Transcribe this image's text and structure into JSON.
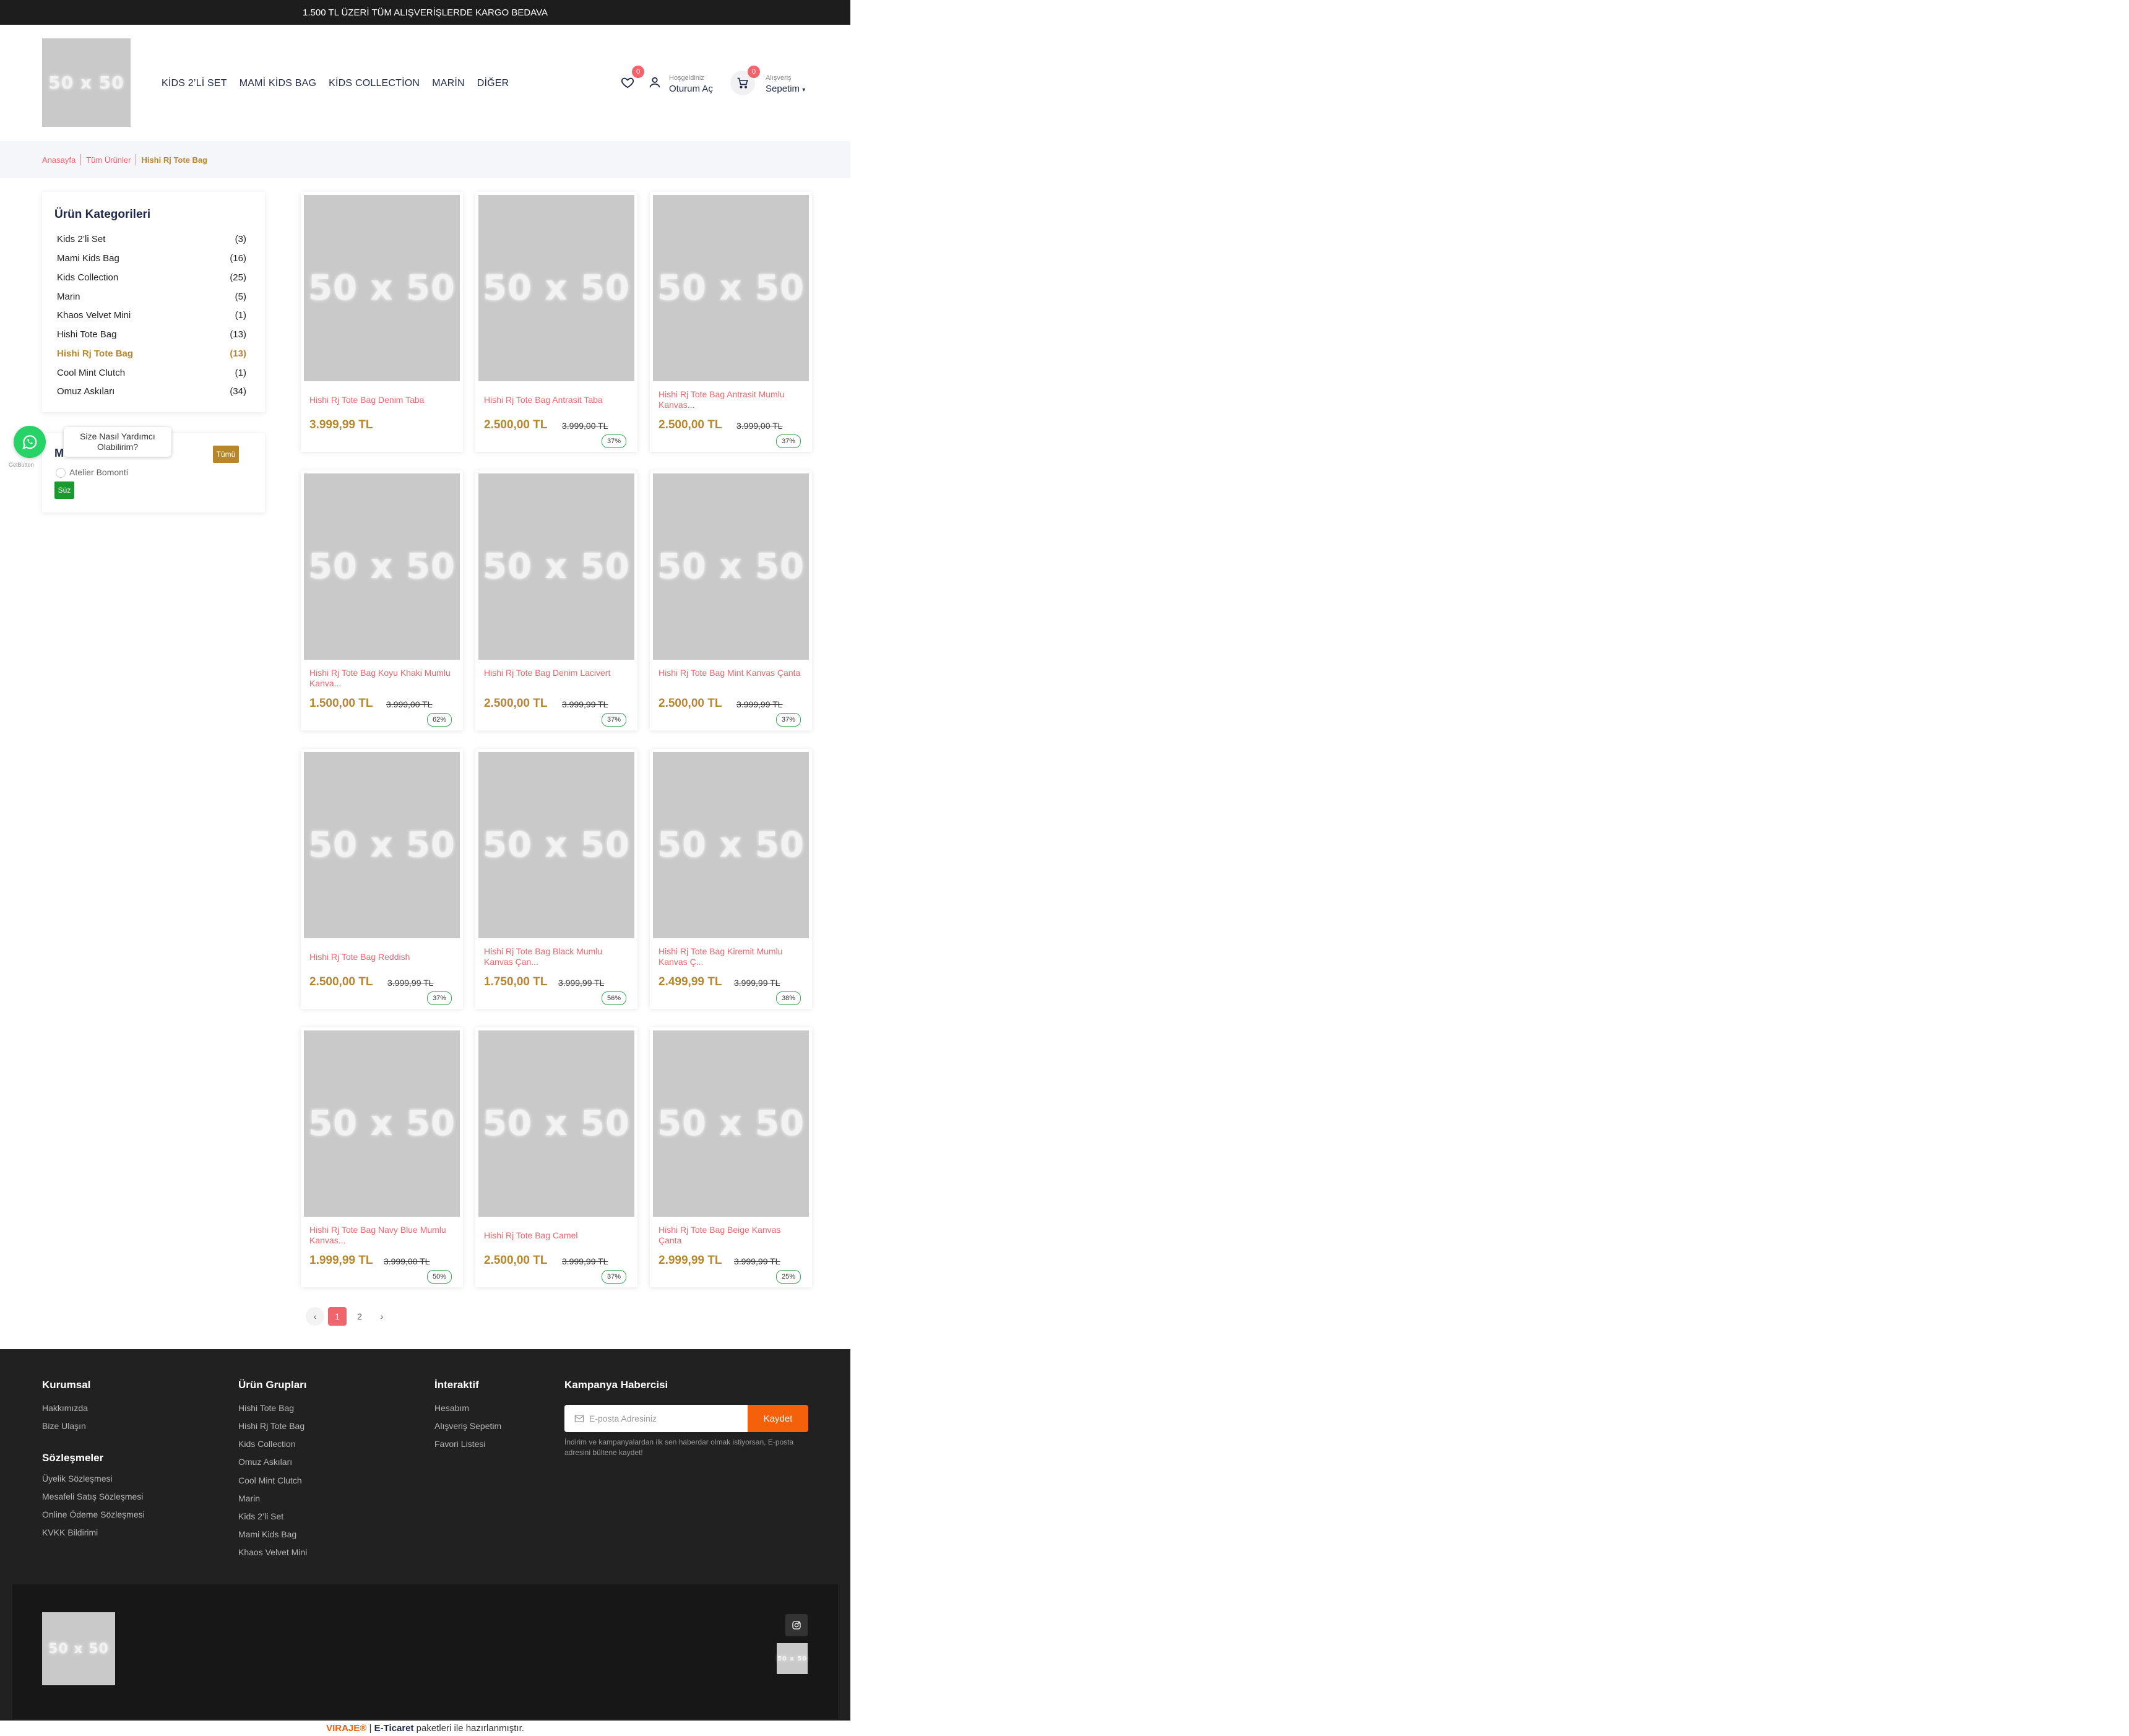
{
  "topbar": {
    "text": "1.500 TL ÜZERİ TÜM ALIŞVERİŞLERDE KARGO BEDAVA"
  },
  "header": {
    "logo": "50 x 50",
    "nav": [
      "KİDS 2’Lİ SET",
      "MAMİ KİDS BAG",
      "KİDS COLLECTİON",
      "MARİN",
      "DİĞER"
    ],
    "wishlist_count": "0",
    "account_small": "Hoşgeldiniz",
    "account_main": "Oturum Aç",
    "cart_count": "0",
    "cart_small": "Alışveriş",
    "cart_main": "Sepetim"
  },
  "breadcrumb": [
    "Anasayfa",
    "Tüm Ürünler",
    "Hishi Rj Tote Bag"
  ],
  "sidebar": {
    "categories_title": "Ürün Kategorileri",
    "categories": [
      {
        "name": "Kids 2’li Set",
        "count": "(3)"
      },
      {
        "name": "Mami Kids Bag",
        "count": "(16)"
      },
      {
        "name": "Kids Collection",
        "count": "(25)"
      },
      {
        "name": "Marin",
        "count": "(5)"
      },
      {
        "name": "Khaos Velvet Mini",
        "count": "(1)"
      },
      {
        "name": "Hishi Tote Bag",
        "count": "(13)"
      },
      {
        "name": "Hishi Rj Tote Bag",
        "count": "(13)",
        "active": true
      },
      {
        "name": "Cool Mint Clutch",
        "count": "(1)"
      },
      {
        "name": "Omuz Askıları",
        "count": "(34)"
      }
    ],
    "brand_title": "M",
    "brand_all": "Tümü",
    "brand_option": "Atelier Bomonti",
    "brand_filter": "Süz"
  },
  "whatsapp": {
    "tooltip": "Size Nasıl Yardımcı Olabilirim?",
    "credit": "GetButton"
  },
  "products": [
    {
      "name": "Hishi Rj Tote Bag Denim Taba",
      "price": "3.999,99 TL",
      "old": "",
      "discount": ""
    },
    {
      "name": "Hishi Rj Tote Bag Antrasit Taba",
      "price": "2.500,00 TL",
      "old": "3.999,00 TL",
      "discount": "37%"
    },
    {
      "name": "Hishi Rj Tote Bag Antrasit Mumlu Kanvas...",
      "price": "2.500,00 TL",
      "old": "3.999,00 TL",
      "discount": "37%"
    },
    {
      "name": "Hishi Rj Tote Bag Koyu Khaki Mumlu Kanva...",
      "price": "1.500,00 TL",
      "old": "3.999,00 TL",
      "discount": "62%"
    },
    {
      "name": "Hishi Rj Tote Bag Denim Lacivert",
      "price": "2.500,00 TL",
      "old": "3.999,99 TL",
      "discount": "37%"
    },
    {
      "name": "Hishi Rj Tote Bag Mint Kanvas Çanta",
      "price": "2.500,00 TL",
      "old": "3.999,99 TL",
      "discount": "37%"
    },
    {
      "name": "Hishi Rj Tote Bag Reddish",
      "price": "2.500,00 TL",
      "old": "3.999,99 TL",
      "discount": "37%"
    },
    {
      "name": "Hishi Rj Tote Bag Black Mumlu Kanvas Çan...",
      "price": "1.750,00 TL",
      "old": "3.999,99 TL",
      "discount": "56%"
    },
    {
      "name": "Hishi Rj Tote Bag Kiremit Mumlu Kanvas Ç...",
      "price": "2.499,99 TL",
      "old": "3.999,99 TL",
      "discount": "38%"
    },
    {
      "name": "Hishi Rj Tote Bag Navy Blue Mumlu Kanvas...",
      "price": "1.999,99 TL",
      "old": "3.999,00 TL",
      "discount": "50%"
    },
    {
      "name": "Hishi Rj Tote Bag Camel",
      "price": "2.500,00 TL",
      "old": "3.999,99 TL",
      "discount": "37%"
    },
    {
      "name": "Hishi Rj Tote Bag Beige Kanvas Çanta",
      "price": "2.999,99 TL",
      "old": "3.999,99 TL",
      "discount": "25%"
    }
  ],
  "product_image": "50 x 50",
  "pagination": {
    "prev": "‹",
    "pages": [
      "1",
      "2"
    ],
    "current": "1",
    "next": "›"
  },
  "footer": {
    "kurumsal": {
      "title": "Kurumsal",
      "links": [
        "Hakkımızda",
        "Bize Ulaşın"
      ]
    },
    "sozlesmeler": {
      "title": "Sözleşmeler",
      "links": [
        "Üyelik Sözleşmesi",
        "Mesafeli Satış Sözleşmesi",
        "Online Ödeme Sözleşmesi",
        "KVKK Bildirimi"
      ]
    },
    "urun_gruplari": {
      "title": "Ürün Grupları",
      "links": [
        "Hishi Tote Bag",
        "Hishi Rj Tote Bag",
        "Kids Collection",
        "Omuz Askıları",
        "Cool Mint Clutch",
        "Marin",
        "Kids 2’li Set",
        "Mami Kids Bag",
        "Khaos Velvet Mini"
      ]
    },
    "interaktif": {
      "title": "İnteraktif",
      "links": [
        "Hesabım",
        "Alışveriş Sepetim",
        "Favori Listesi"
      ]
    },
    "newsletter": {
      "title": "Kampanya Habercisi",
      "placeholder": "E-posta Adresiniz",
      "button": "Kaydet",
      "note": "İndirim ve kampanyalardan ilk sen haberdar olmak istiyorsan, E-posta adresini bültene kaydet!"
    },
    "logo": "50 x 50",
    "badge": "50 x 50"
  },
  "credit": {
    "brand": "VIRAJE®",
    "sep": " | ",
    "product": "E-Ticaret",
    "rest": " paketleri ile hazırlanmıştır."
  },
  "colors": {
    "accent": "#f0646b",
    "gold": "#b8862b",
    "footer_bg": "#212121",
    "orange": "#f5600a"
  }
}
